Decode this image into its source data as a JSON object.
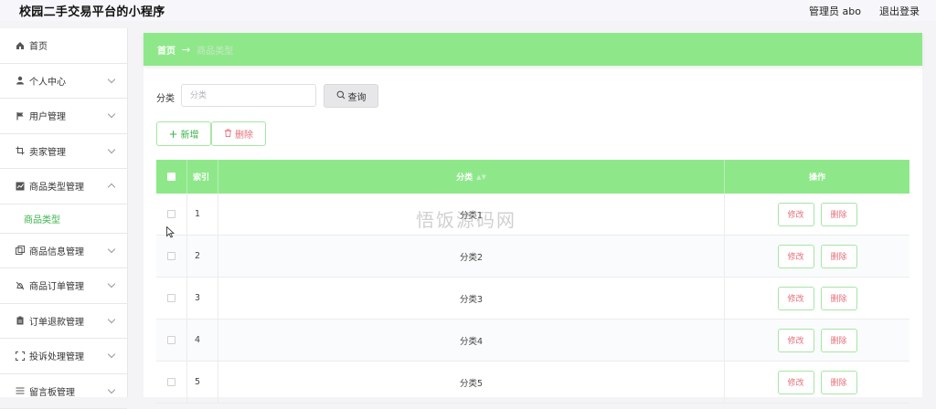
{
  "app": {
    "title": "校园二手交易平台的小程序"
  },
  "topbar": {
    "user_label": "管理员 abo",
    "logout_label": "退出登录"
  },
  "sidebar": {
    "items": [
      {
        "label": "首页",
        "icon": "home-icon",
        "has_chevron": false
      },
      {
        "label": "个人中心",
        "icon": "user-icon",
        "has_chevron": true
      },
      {
        "label": "用户管理",
        "icon": "flag-icon",
        "has_chevron": true
      },
      {
        "label": "卖家管理",
        "icon": "crop-icon",
        "has_chevron": true
      },
      {
        "label": "商品类型管理",
        "icon": "chart-icon",
        "has_chevron": true,
        "expanded": true
      },
      {
        "label": "商品信息管理",
        "icon": "copy-icon",
        "has_chevron": true
      },
      {
        "label": "商品订单管理",
        "icon": "bell-off-icon",
        "has_chevron": true
      },
      {
        "label": "订单退款管理",
        "icon": "clipboard-icon",
        "has_chevron": true
      },
      {
        "label": "投诉处理管理",
        "icon": "fullscreen-icon",
        "has_chevron": true
      },
      {
        "label": "留言板管理",
        "icon": "list-icon",
        "has_chevron": true
      }
    ],
    "sub_item": "商品类型"
  },
  "breadcrumb": {
    "home": "首页",
    "arrow": "→",
    "current": "商品类型"
  },
  "search": {
    "label": "分类",
    "placeholder": "分类",
    "button_label": "查询"
  },
  "actions": {
    "add_label": "新增",
    "delete_label": "删除"
  },
  "table": {
    "headers": {
      "index": "索引",
      "name": "分类",
      "ops": "操作"
    },
    "rows": [
      {
        "index": "1",
        "name": "分类1"
      },
      {
        "index": "2",
        "name": "分类2"
      },
      {
        "index": "3",
        "name": "分类3"
      },
      {
        "index": "4",
        "name": "分类4"
      },
      {
        "index": "5",
        "name": "分类5"
      }
    ],
    "edit_label": "修改",
    "delete_label": "删除"
  },
  "watermark": "悟饭源码网",
  "colors": {
    "accent": "#8ee88a",
    "brand_green": "#39b54a",
    "danger": "#e5707a"
  }
}
